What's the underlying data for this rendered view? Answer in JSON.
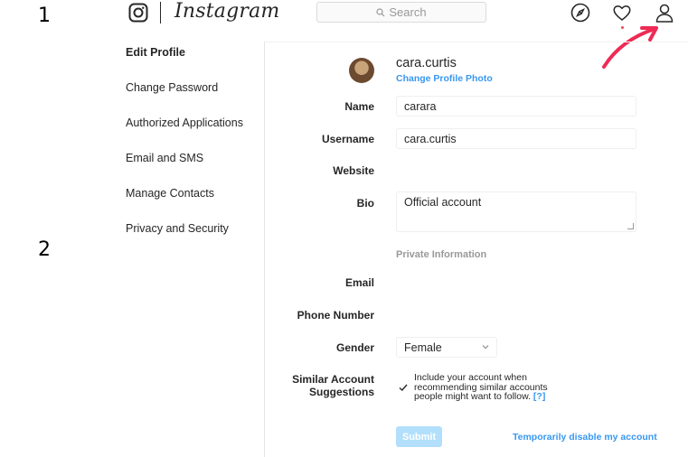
{
  "annotations": {
    "step1": "1",
    "step2": "2"
  },
  "header": {
    "wordmark": "Instagram",
    "search_placeholder": "Search",
    "icons": [
      "instagram-glyph-icon",
      "search-icon",
      "explore-compass-icon",
      "heart-icon",
      "profile-person-icon"
    ],
    "arrow_color": "#ee2a54"
  },
  "sidebar": {
    "items": [
      {
        "label": "Edit Profile",
        "active": true
      },
      {
        "label": "Change Password"
      },
      {
        "label": "Authorized Applications"
      },
      {
        "label": "Email and SMS"
      },
      {
        "label": "Manage Contacts"
      },
      {
        "label": "Privacy and Security"
      }
    ]
  },
  "profile": {
    "username": "cara.curtis",
    "change_photo": "Change Profile Photo"
  },
  "form": {
    "name_label": "Name",
    "name_value": "carara",
    "username_label": "Username",
    "username_value": "cara.curtis",
    "website_label": "Website",
    "bio_label": "Bio",
    "bio_value": "Official account",
    "private_heading": "Private Information",
    "email_label": "Email",
    "phone_label": "Phone Number",
    "gender_label": "Gender",
    "gender_value": "Female",
    "similar_label_line1": "Similar Account",
    "similar_label_line2": "Suggestions",
    "similar_text": "Include your account when recommending similar accounts people might want to follow.",
    "help_link": "[?]",
    "submit": "Submit",
    "disable_link": "Temporarily disable my account"
  },
  "colors": {
    "accent": "#3897f0",
    "submit_disabled": "#b2dffc",
    "notification": "#ed4956"
  }
}
